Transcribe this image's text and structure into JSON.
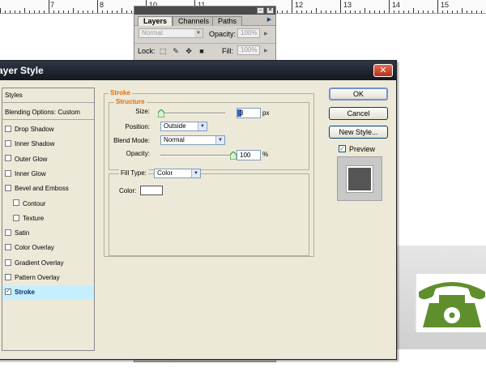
{
  "ruler": {
    "numbers": [
      "7",
      "8",
      "10",
      "11",
      "12",
      "13",
      "14",
      "15"
    ]
  },
  "layers_panel": {
    "tabs": [
      "Layers",
      "Channels",
      "Paths"
    ],
    "blend_mode": "Normal",
    "opacity_label": "Opacity:",
    "opacity_value": "100%",
    "lock_label": "Lock:",
    "fill_label": "Fill:",
    "fill_value": "100%"
  },
  "dialog": {
    "title": "ayer Style",
    "close_glyph": "✕",
    "styles_list": [
      {
        "label": "Styles",
        "checkbox": false,
        "checked": false,
        "sub": false,
        "selected": false
      },
      {
        "label": "Blending Options: Custom",
        "checkbox": false,
        "checked": false,
        "sub": false,
        "selected": false
      },
      {
        "label": "Drop Shadow",
        "checkbox": true,
        "checked": false,
        "sub": false,
        "selected": false
      },
      {
        "label": "Inner Shadow",
        "checkbox": true,
        "checked": false,
        "sub": false,
        "selected": false
      },
      {
        "label": "Outer Glow",
        "checkbox": true,
        "checked": false,
        "sub": false,
        "selected": false
      },
      {
        "label": "Inner Glow",
        "checkbox": true,
        "checked": false,
        "sub": false,
        "selected": false
      },
      {
        "label": "Bevel and Emboss",
        "checkbox": true,
        "checked": false,
        "sub": false,
        "selected": false
      },
      {
        "label": "Contour",
        "checkbox": true,
        "checked": false,
        "sub": true,
        "selected": false
      },
      {
        "label": "Texture",
        "checkbox": true,
        "checked": false,
        "sub": true,
        "selected": false
      },
      {
        "label": "Satin",
        "checkbox": true,
        "checked": false,
        "sub": false,
        "selected": false
      },
      {
        "label": "Color Overlay",
        "checkbox": true,
        "checked": false,
        "sub": false,
        "selected": false
      },
      {
        "label": "Gradient Overlay",
        "checkbox": true,
        "checked": false,
        "sub": false,
        "selected": false
      },
      {
        "label": "Pattern Overlay",
        "checkbox": true,
        "checked": false,
        "sub": false,
        "selected": false
      },
      {
        "label": "Stroke",
        "checkbox": true,
        "checked": true,
        "sub": false,
        "selected": true
      }
    ],
    "stroke": {
      "group_title": "Stroke",
      "structure_title": "Structure",
      "size_label": "Size:",
      "size_value": "3",
      "size_unit": "px",
      "size_fraction": 0.01,
      "position_label": "Position:",
      "position_value": "Outside",
      "blend_mode_label": "Blend Mode:",
      "blend_mode_value": "Normal",
      "opacity_label": "Opacity:",
      "opacity_value": "100",
      "opacity_unit": "%",
      "opacity_fraction": 1.0,
      "fill_type_label": "Fill Type:",
      "fill_type_value": "Color",
      "color_label": "Color:",
      "color_value": "#ffffff"
    },
    "buttons": {
      "ok": "OK",
      "cancel": "Cancel",
      "new_style": "New Style..."
    },
    "preview_label": "Preview",
    "preview_checked": true
  },
  "colors": {
    "accent_orange": "#e06d0d",
    "selected_bg": "#c5efff",
    "phone_green": "#5f8f2d",
    "preview_swatch": "#555555"
  }
}
